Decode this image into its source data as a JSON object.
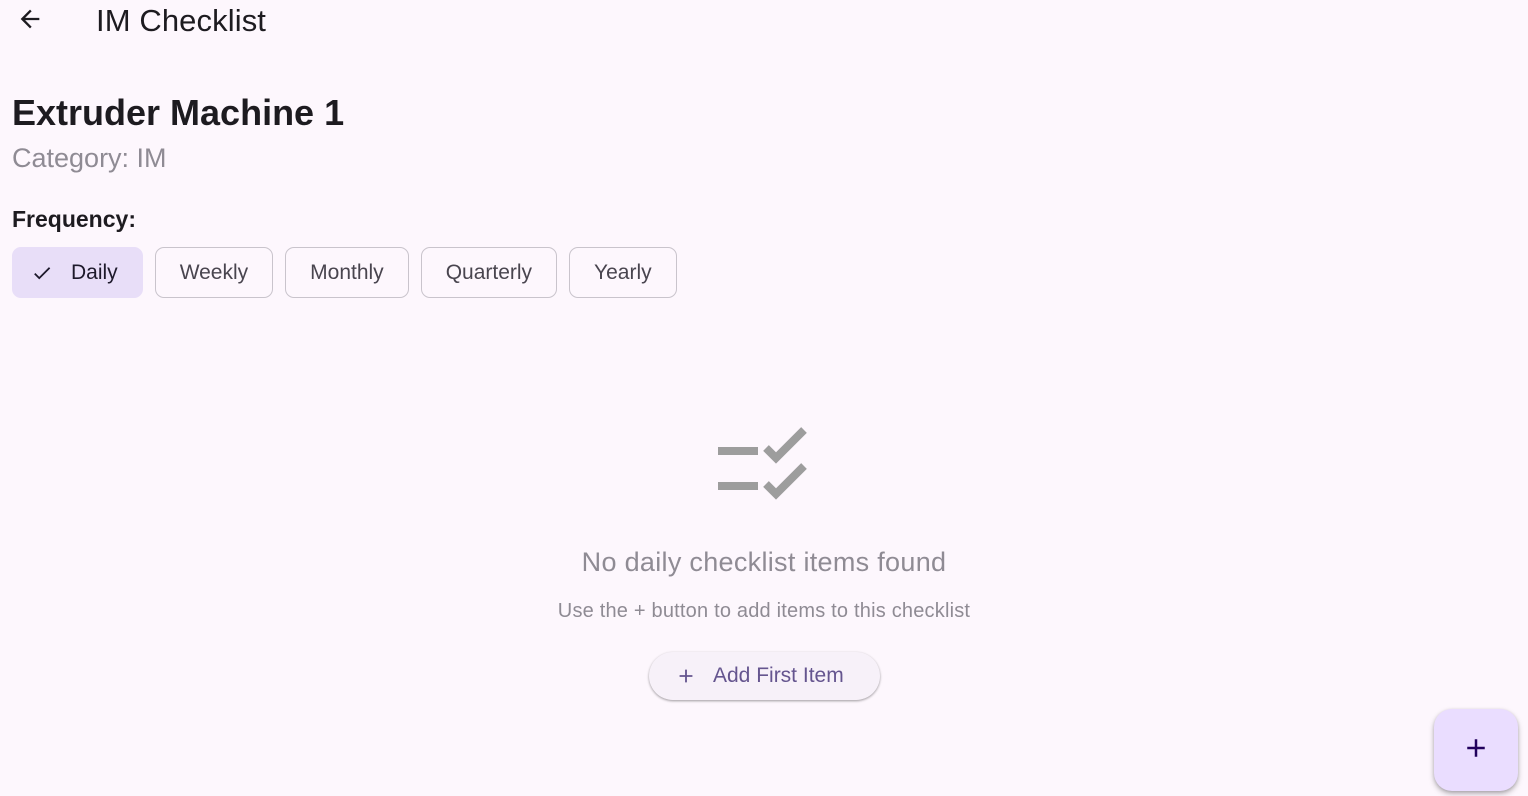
{
  "appbar": {
    "title": "IM Checklist",
    "back_icon": "arrow-back-icon"
  },
  "machine": {
    "name": "Extruder Machine 1",
    "category": "Category: IM"
  },
  "frequency": {
    "label": "Frequency:",
    "options": [
      "Daily",
      "Weekly",
      "Monthly",
      "Quarterly",
      "Yearly"
    ],
    "selected": "Daily"
  },
  "empty_state": {
    "icon": "checklist-icon",
    "title": "No daily checklist items found",
    "subtitle": "Use the + button to add items to this checklist",
    "button_label": "Add First Item"
  },
  "fab": {
    "icon": "add-icon"
  },
  "colors": {
    "background": "#fdf7fd",
    "selected_chip": "#e8def8",
    "fab": "#eaddff",
    "accent_text": "#65558f",
    "muted_text": "#8f8b94"
  }
}
